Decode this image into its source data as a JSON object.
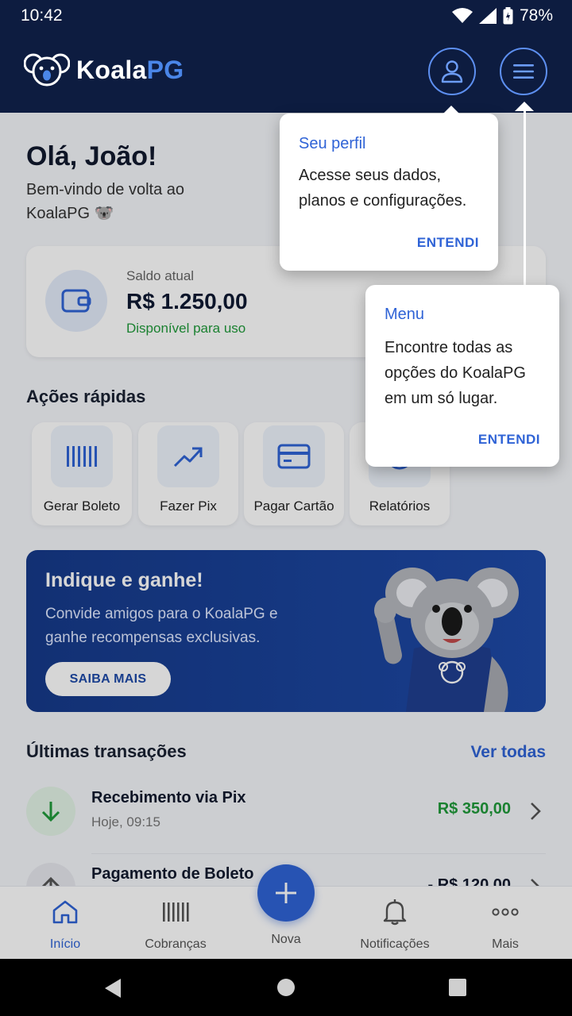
{
  "status_bar": {
    "time": "10:42",
    "battery": "78%"
  },
  "header": {
    "brand_main": "Koala",
    "brand_accent": "PG"
  },
  "greeting": {
    "title": "Olá, João!",
    "subtitle": "Bem-vindo de volta ao KoalaPG 🐨"
  },
  "balance": {
    "label": "Saldo atual",
    "value": "R$ 1.250,00",
    "status": "Disponível para uso"
  },
  "quick_actions": {
    "title": "Ações rápidas",
    "items": [
      {
        "label": "Gerar Boleto",
        "icon": "barcode-icon"
      },
      {
        "label": "Fazer Pix",
        "icon": "pix-trend-icon"
      },
      {
        "label": "Pagar Cartão",
        "icon": "card-icon"
      },
      {
        "label": "Relatórios",
        "icon": "reports-icon"
      }
    ]
  },
  "promo": {
    "title": "Indique e ganhe!",
    "text": "Convide amigos para o KoalaPG e ganhe recompensas exclusivas.",
    "button": "SAIBA MAIS"
  },
  "transactions": {
    "title": "Últimas transações",
    "see_all": "Ver todas",
    "items": [
      {
        "title": "Recebimento via Pix",
        "time": "Hoje, 09:15",
        "amount": "R$ 350,00",
        "type": "in"
      },
      {
        "title": "Pagamento de Boleto",
        "time": "",
        "amount": "- R$ 120,00",
        "type": "out"
      }
    ]
  },
  "bottom_nav": {
    "items": [
      {
        "label": "Início",
        "icon": "home-icon",
        "active": true
      },
      {
        "label": "Cobranças",
        "icon": "barcode-icon"
      },
      {
        "label": "Nova",
        "icon": "plus-icon"
      },
      {
        "label": "Notificações",
        "icon": "bell-icon"
      },
      {
        "label": "Mais",
        "icon": "more-icon"
      }
    ]
  },
  "tooltips": {
    "profile": {
      "title": "Seu perfil",
      "body": "Acesse seus dados, planos e configurações.",
      "button": "ENTENDI"
    },
    "menu": {
      "title": "Menu",
      "body": "Encontre todas as opções do KoalaPG em um só lugar.",
      "button": "ENTENDI"
    }
  },
  "colors": {
    "header_bg": "#0d1c40",
    "accent": "#2f63d6",
    "positive": "#1f9a3a",
    "promo_bg": "#1e4aa8"
  }
}
